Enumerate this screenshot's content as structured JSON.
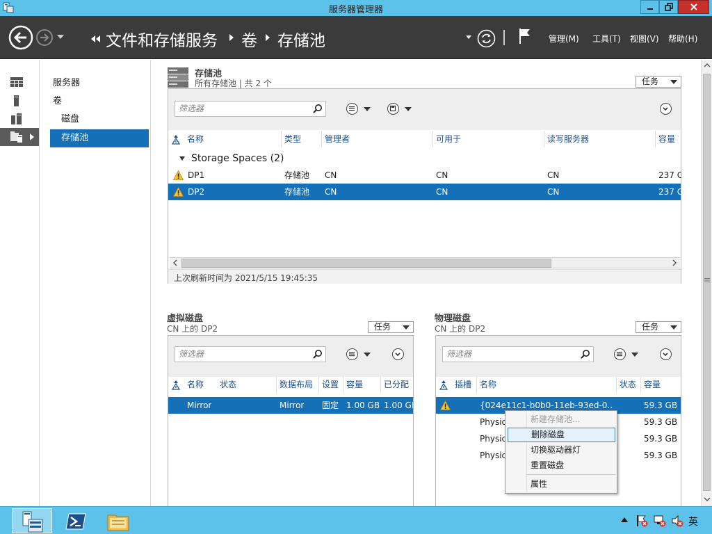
{
  "window": {
    "title": "服务器管理器"
  },
  "nav": {
    "breadcrumb": [
      "文件和存储服务",
      "卷",
      "存储池"
    ],
    "menu": [
      "管理(M)",
      "工具(T)",
      "视图(V)",
      "帮助(H)"
    ]
  },
  "tree": {
    "items": [
      {
        "label": "服务器",
        "level": 0,
        "active": false
      },
      {
        "label": "卷",
        "level": 0,
        "active": false
      },
      {
        "label": "磁盘",
        "level": 1,
        "active": false
      },
      {
        "label": "存储池",
        "level": 1,
        "active": true
      }
    ]
  },
  "pools": {
    "title": "存储池",
    "subtitle": "所有存储池 | 共 2 个",
    "tasks_label": "任务",
    "filter_placeholder": "筛选器",
    "columns": [
      "名称",
      "类型",
      "管理者",
      "可用于",
      "读写服务器",
      "容量"
    ],
    "group_label": "Storage Spaces (2)",
    "rows": [
      {
        "name": "DP1",
        "type": "存储池",
        "managed_by": "CN",
        "available_to": "CN",
        "rw_server": "CN",
        "capacity": "237 G",
        "selected": false
      },
      {
        "name": "DP2",
        "type": "存储池",
        "managed_by": "CN",
        "available_to": "CN",
        "rw_server": "CN",
        "capacity": "237 G",
        "selected": true
      }
    ],
    "last_refresh": "上次刷新时间为 2021/5/15 19:45:35"
  },
  "vdisks": {
    "title": "虚拟磁盘",
    "subtitle": "CN 上的 DP2",
    "tasks_label": "任务",
    "filter_placeholder": "筛选器",
    "columns": [
      "名称",
      "状态",
      "数据布局",
      "设置",
      "容量",
      "已分配"
    ],
    "rows": [
      {
        "name": "Mirror",
        "status": "",
        "layout": "Mirror",
        "provisioning": "固定",
        "capacity": "1.00 GB",
        "allocated": "1.00 GB"
      }
    ]
  },
  "pdisks": {
    "title": "物理磁盘",
    "subtitle": "CN 上的 DP2",
    "tasks_label": "任务",
    "filter_placeholder": "筛选器",
    "columns": [
      "插槽",
      "名称",
      "状态",
      "容量"
    ],
    "rows": [
      {
        "name": "{024e11c1-b0b0-11eb-93ed-0...",
        "capacity": "59.3 GB",
        "warn": true,
        "selected": true
      },
      {
        "name": "Physic",
        "capacity": "59.3 GB",
        "warn": false,
        "selected": false
      },
      {
        "name": "Physic",
        "capacity": "59.3 GB",
        "warn": false,
        "selected": false
      },
      {
        "name": "Physic",
        "capacity": "59.3 GB",
        "warn": false,
        "selected": false
      }
    ]
  },
  "context_menu": {
    "items": [
      {
        "label": "新建存储池...",
        "disabled": true,
        "hover": false
      },
      {
        "label": "删除磁盘",
        "disabled": false,
        "hover": true
      },
      {
        "label": "切换驱动器灯",
        "disabled": false,
        "hover": false
      },
      {
        "label": "重置磁盘",
        "disabled": false,
        "hover": false
      },
      {
        "label": "属性",
        "disabled": false,
        "hover": false
      }
    ]
  },
  "taskbar": {
    "apps": [
      "server-manager",
      "powershell",
      "file-explorer"
    ],
    "ime_label": "英"
  },
  "colors": {
    "titlebar": "#5cc2ea",
    "navbar": "#3b3b3b",
    "selection": "#1570b8",
    "close_button": "#c8312b"
  }
}
